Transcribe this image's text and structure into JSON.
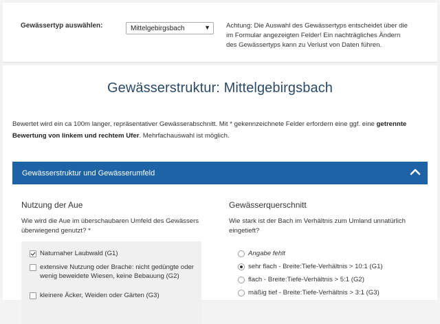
{
  "header": {
    "type_label": "Gewässertyp auswählen:",
    "type_selected": "Mittelgebirgsbach",
    "warning_line1": "Achtung: Die Auswahl des Gewässertyps entscheidet über die",
    "warning_line2": "im Formular angezeigten Felder! Ein nachträgliches Ändern",
    "warning_line3": "des Gewässertyps kann zu Verlust von Daten führen."
  },
  "page": {
    "title": "Gewässerstruktur: Mittelgebirgsbach",
    "intro_part1": "Bewertet wird ein ca 100m langer, repräsentativer Gewässerabschnitt. Mit * gekennzeichnete Felder erfordern eine ggf. eine ",
    "intro_bold": "getrennte Bewertung von linkem und rechtem Ufer",
    "intro_part2": ". Mehrfachauswahl ist möglich."
  },
  "section": {
    "title": "Gewässerstruktur und Gewässerumfeld",
    "chevron_icon": "chevron-up-icon"
  },
  "left": {
    "heading": "Nutzung der Aue",
    "question": "Wie wird die Aue im überschaubaren Umfeld des Gewässers überwiegend genutzt? *",
    "options": [
      {
        "label": "Naturnaher Laubwald (G1)",
        "checked": true
      },
      {
        "label": "extensive Nutzung oder Brache: nicht gedüngte oder wenig beweidete Wiesen, keine Bebauung (G2)",
        "checked": false
      },
      {
        "label": "kleinere Äcker, Weiden oder Gärten (G3)",
        "checked": false
      }
    ]
  },
  "right": {
    "heading": "Gewässerquerschnitt",
    "question": "Wie stark ist der Bach im Verhältnis zum Umland unnatürlich eingetieft?",
    "options": [
      {
        "label": "Angabe fehlt",
        "selected": false
      },
      {
        "label": "sehr flach - Breite:Tiefe-Verhältnis > 10:1 (G1)",
        "selected": true
      },
      {
        "label": "flach - Breite:Tiefe-Verhältnis > 5:1 (G2)",
        "selected": false
      },
      {
        "label": "mäßig tief - Breite:Tiefe-Verhältnis > 3:1 (G3)",
        "selected": false
      }
    ]
  },
  "colors": {
    "section_bar": "#1d63a5",
    "title": "#2b4a66"
  }
}
